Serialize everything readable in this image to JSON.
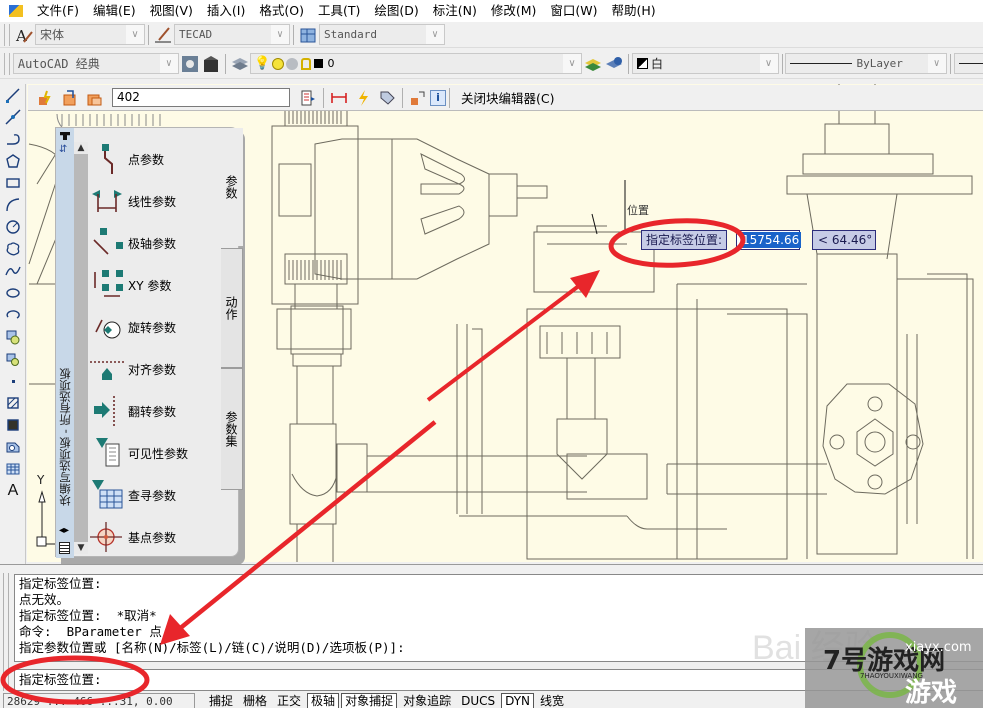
{
  "menubar": {
    "items": [
      "文件(F)",
      "编辑(E)",
      "视图(V)",
      "插入(I)",
      "格式(O)",
      "工具(T)",
      "绘图(D)",
      "标注(N)",
      "修改(M)",
      "窗口(W)",
      "帮助(H)"
    ]
  },
  "toolbar_styles": {
    "text_style": "宋体",
    "dim_style": "TECAD",
    "table_style": "Standard"
  },
  "toolbar_workspace": {
    "workspace": "AutoCAD 经典",
    "layer": "0",
    "color": "白",
    "linetype": "ByLayer"
  },
  "block_editor": {
    "block_name": "402",
    "close_label": "关闭块编辑器(C)"
  },
  "palette": {
    "title": "块编写选项板 - 所有选项板",
    "items": [
      {
        "label": "点参数",
        "icon": "point-parameter-icon"
      },
      {
        "label": "线性参数",
        "icon": "linear-parameter-icon"
      },
      {
        "label": "极轴参数",
        "icon": "polar-parameter-icon"
      },
      {
        "label": "XY 参数",
        "icon": "xy-parameter-icon"
      },
      {
        "label": "旋转参数",
        "icon": "rotation-parameter-icon"
      },
      {
        "label": "对齐参数",
        "icon": "alignment-parameter-icon"
      },
      {
        "label": "翻转参数",
        "icon": "flip-parameter-icon"
      },
      {
        "label": "可见性参数",
        "icon": "visibility-parameter-icon"
      },
      {
        "label": "查寻参数",
        "icon": "lookup-parameter-icon"
      },
      {
        "label": "基点参数",
        "icon": "basepoint-parameter-icon"
      }
    ],
    "tabs": [
      "参数",
      "动作",
      "参数集"
    ]
  },
  "dynamic_input": {
    "prompt": "指定标签位置:",
    "distance": "15754.66",
    "angle": "< 64.46°"
  },
  "ucs": {
    "y_label": "Y"
  },
  "command": {
    "history": [
      "指定标签位置:",
      "点无效。",
      "指定标签位置:  *取消*",
      "命令:  BParameter 点",
      "指定参数位置或 [名称(N)/标签(L)/链(C)/说明(D)/选项板(P)]:"
    ],
    "current": "指定标签位置:"
  },
  "statusbar": {
    "coords": "28629 ...  466 ...31, 0.00",
    "buttons": [
      {
        "label": "捕捉",
        "on": false
      },
      {
        "label": "栅格",
        "on": false
      },
      {
        "label": "正交",
        "on": false
      },
      {
        "label": "极轴",
        "on": true
      },
      {
        "label": "对象捕捉",
        "on": true
      },
      {
        "label": "对象追踪",
        "on": false
      },
      {
        "label": "DUCS",
        "on": false
      },
      {
        "label": "DYN",
        "on": true
      },
      {
        "label": "线宽",
        "on": false
      }
    ]
  },
  "watermark": {
    "baidu": "Bai 经验",
    "site": "xiayx.com",
    "brand": "7号游戏网",
    "brand_pinyin": "7HAOYOUXIWANG",
    "brand_sub": "游戏"
  },
  "colors": {
    "canvas_bg": "#fefbe6",
    "annotation_red": "#e8262b",
    "dyn_input_bg": "#c6cbe6",
    "selection_blue": "#1a63c9",
    "param_teal": "#1d7a74"
  }
}
